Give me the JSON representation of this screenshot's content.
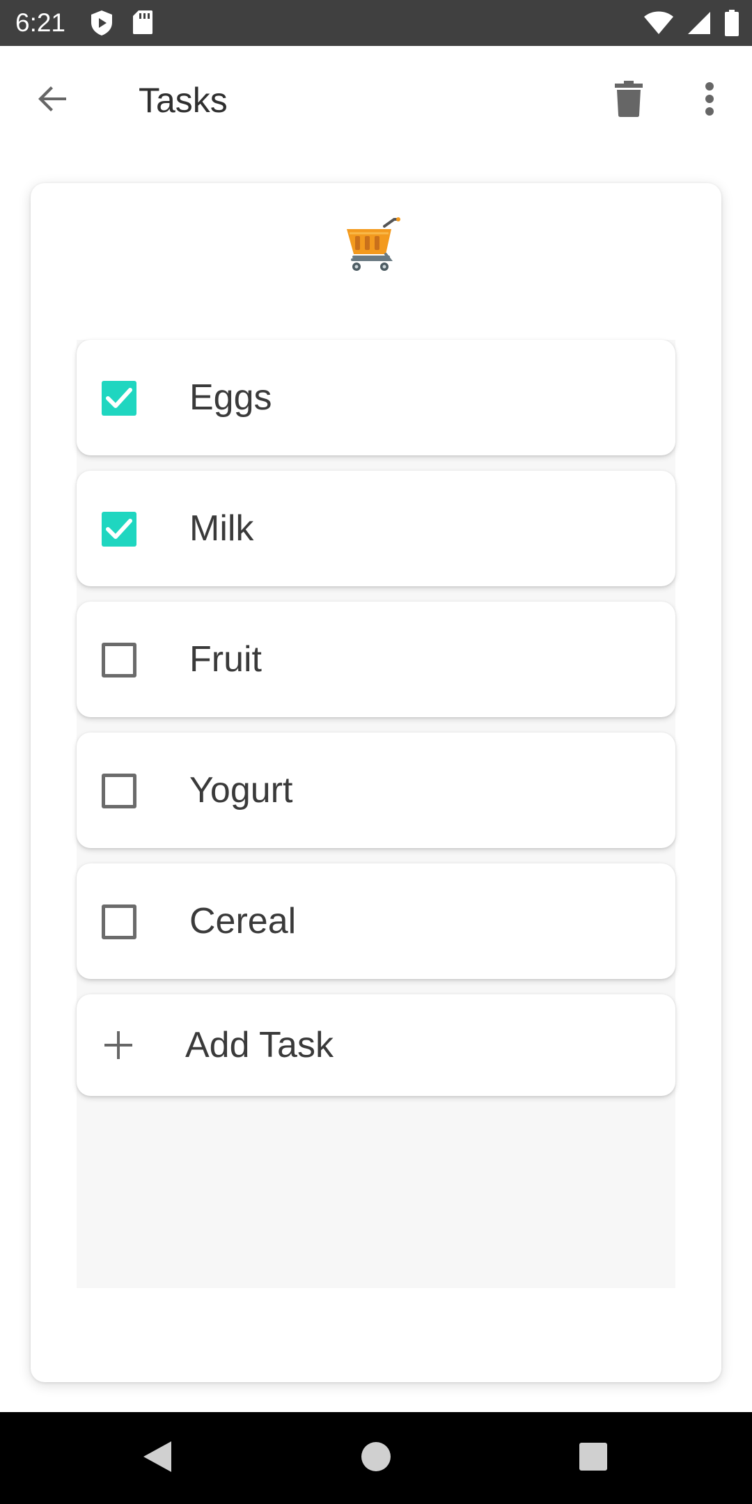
{
  "status_bar": {
    "time": "6:21",
    "left_icons": [
      "shield-play-icon",
      "sd-card-icon"
    ],
    "right_icons": [
      "wifi-icon",
      "signal-icon",
      "battery-icon"
    ]
  },
  "app_bar": {
    "title": "Tasks",
    "back_icon": "arrow-back-icon",
    "actions": [
      "delete-icon",
      "more-vert-icon"
    ]
  },
  "list": {
    "icon": "shopping-cart-icon",
    "tasks": [
      {
        "label": "Eggs",
        "checked": true
      },
      {
        "label": "Milk",
        "checked": true
      },
      {
        "label": "Fruit",
        "checked": false
      },
      {
        "label": "Yogurt",
        "checked": false
      },
      {
        "label": "Cereal",
        "checked": false
      }
    ],
    "add_task_label": "Add Task"
  },
  "nav_bar": {
    "buttons": [
      "nav-back-icon",
      "nav-home-icon",
      "nav-recents-icon"
    ]
  },
  "colors": {
    "checked": "#1fd6c0",
    "status_bar": "#404040",
    "cart_orange": "#f39a1e"
  }
}
